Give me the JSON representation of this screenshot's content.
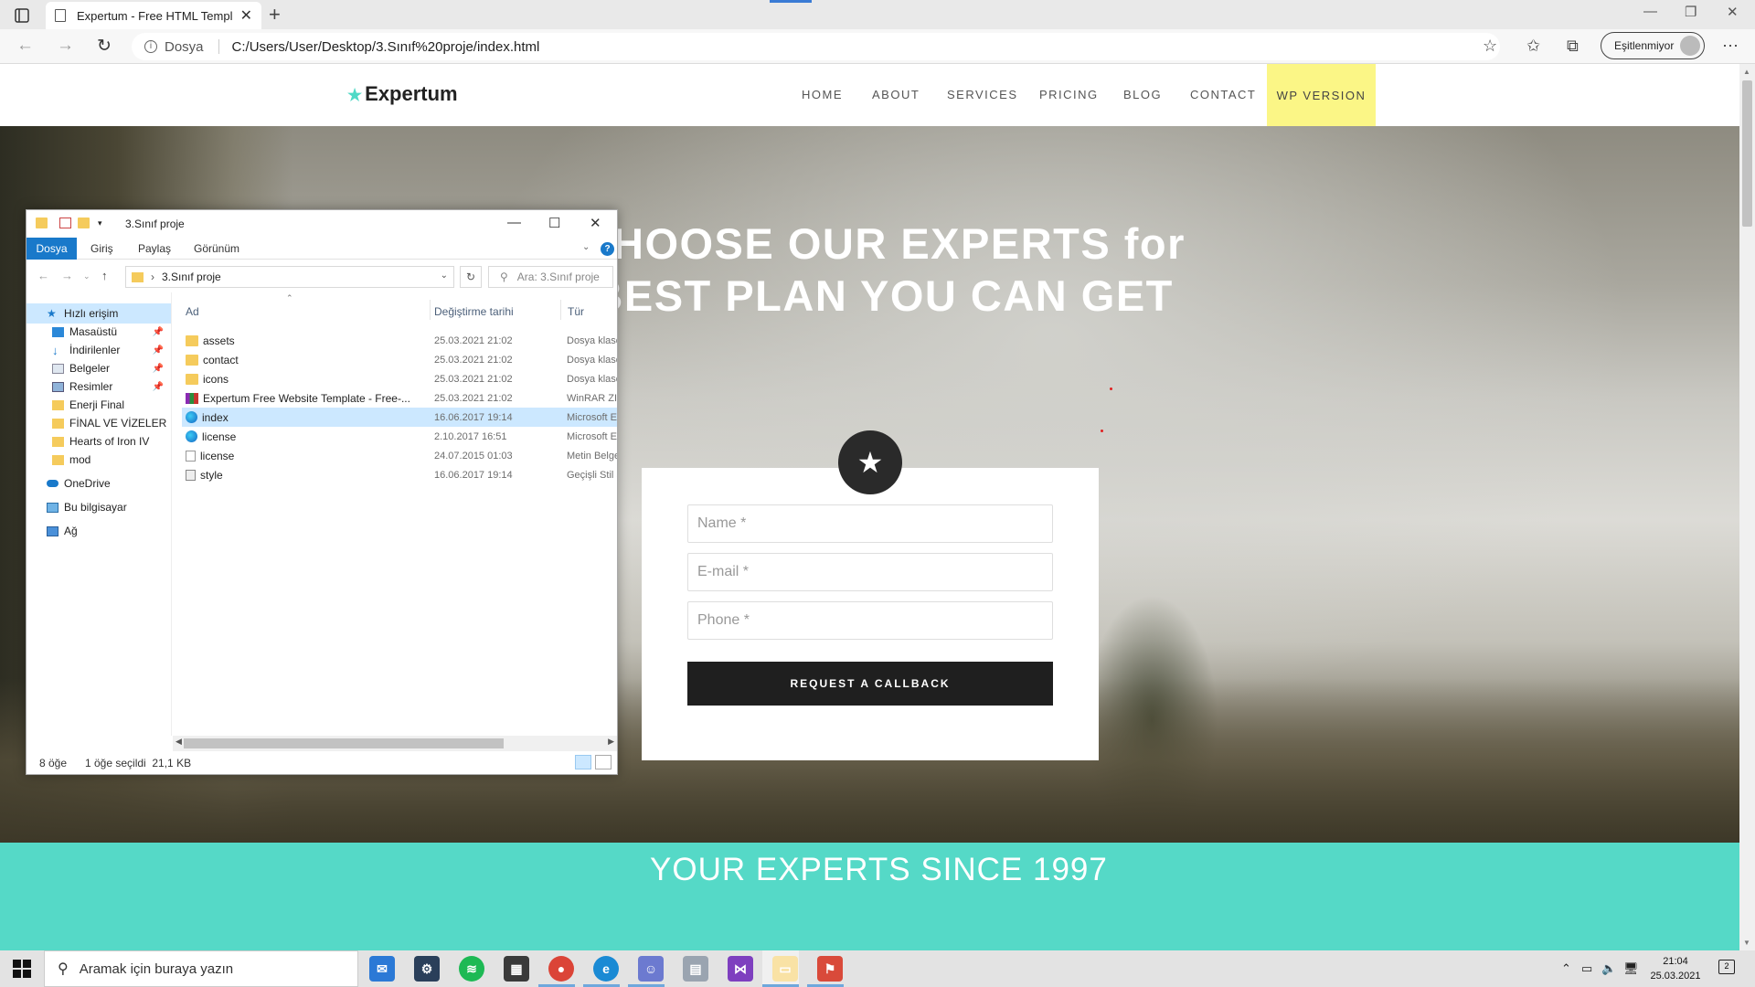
{
  "browser": {
    "tab_title": "Expertum - Free HTML Template",
    "address_protocol": "Dosya",
    "address_url": "C:/Users/User/Desktop/3.Sınıf%20proje/index.html",
    "sync_label": "Eşitlenmiyor"
  },
  "site": {
    "logo": "Expertum",
    "nav": [
      "HOME",
      "ABOUT",
      "SERVICES",
      "PRICING",
      "BLOG",
      "CONTACT"
    ],
    "nav_wp": "WP VERSION",
    "hero_line1": "HOOSE OUR EXPERTS for",
    "hero_line2": "E BEST PLAN YOU CAN GET",
    "form": {
      "name_placeholder": "Name *",
      "email_placeholder": "E-mail *",
      "phone_placeholder": "Phone *",
      "submit_label": "REQUEST A CALLBACK"
    },
    "section_title": "YOUR EXPERTS SINCE 1997",
    "colors": {
      "teal": "#55d9c7",
      "wp_highlight": "#fbf686",
      "accent_star": "#4fd9c6"
    }
  },
  "explorer": {
    "title": "3.Sınıf proje",
    "ribbon_tabs": [
      "Dosya",
      "Giriş",
      "Paylaş",
      "Görünüm"
    ],
    "path": "3.Sınıf proje",
    "search_placeholder": "Ara: 3.Sınıf proje",
    "nav": {
      "quick_access": "Hızlı erişim",
      "quick_items": [
        "Masaüstü",
        "İndirilenler",
        "Belgeler",
        "Resimler"
      ],
      "folders": [
        "Enerji Final",
        "FİNAL VE VİZELER",
        "Hearts of Iron IV",
        "mod"
      ],
      "onedrive": "OneDrive",
      "this_pc": "Bu bilgisayar",
      "network": "Ağ"
    },
    "columns": {
      "name": "Ad",
      "date": "Değiştirme tarihi",
      "type": "Tür"
    },
    "files": [
      {
        "name": "assets",
        "date": "25.03.2021 21:02",
        "type": "Dosya klasörü",
        "icon": "folder-icon"
      },
      {
        "name": "contact",
        "date": "25.03.2021 21:02",
        "type": "Dosya klasörü",
        "icon": "folder-icon"
      },
      {
        "name": "icons",
        "date": "25.03.2021 21:02",
        "type": "Dosya klasörü",
        "icon": "folder-icon"
      },
      {
        "name": "Expertum Free Website Template - Free-...",
        "date": "25.03.2021 21:02",
        "type": "WinRAR ZIP",
        "icon": "winrar-icon"
      },
      {
        "name": "index",
        "date": "16.06.2017 19:14",
        "type": "Microsoft Edge",
        "icon": "edge-icon"
      },
      {
        "name": "license",
        "date": "2.10.2017 16:51",
        "type": "Microsoft Edge",
        "icon": "edge-icon"
      },
      {
        "name": "license",
        "date": "24.07.2015 01:03",
        "type": "Metin Belgesi",
        "icon": "text-file-icon"
      },
      {
        "name": "style",
        "date": "16.06.2017 19:14",
        "type": "Geçişli Stil Sayfası",
        "icon": "css-file-icon"
      }
    ],
    "status_count": "8 öğe",
    "status_selected": "1 öğe seçildi  21,1 KB"
  },
  "taskbar": {
    "search_placeholder": "Aramak için buraya yazın",
    "time": "21:04",
    "date": "25.03.2021"
  }
}
